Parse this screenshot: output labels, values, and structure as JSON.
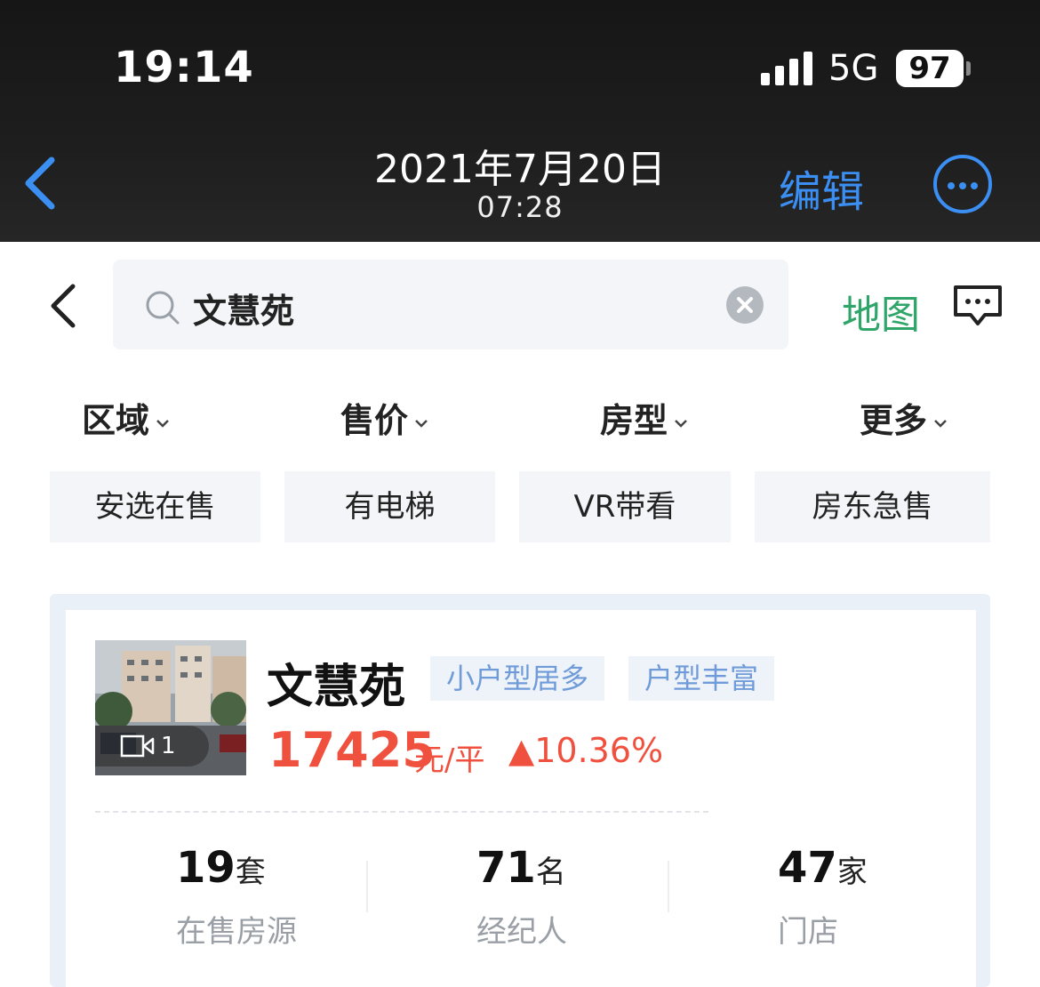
{
  "status_bar": {
    "time": "19:14",
    "network": "5G",
    "battery": "97"
  },
  "viewer": {
    "date": "2021年7月20日",
    "time": "07:28",
    "edit_label": "编辑"
  },
  "search": {
    "query": "文慧苑",
    "map_label": "地图"
  },
  "filters": [
    "区域",
    "售价",
    "房型",
    "更多"
  ],
  "quick_tags": [
    "安选在售",
    "有电梯",
    "VR带看",
    "房东急售"
  ],
  "community": {
    "name": "文慧苑",
    "tags": [
      "小户型居多",
      "户型丰富"
    ],
    "video_count": "1",
    "price": "17425",
    "price_unit": "元/平",
    "price_change": "▲10.36%",
    "stats": [
      {
        "value": "19",
        "unit": "套",
        "label": "在售房源"
      },
      {
        "value": "71",
        "unit": "名",
        "label": "经纪人"
      },
      {
        "value": "47",
        "unit": "家",
        "label": "门店"
      }
    ]
  },
  "colors": {
    "accent_blue": "#3b8ff2",
    "map_green": "#2fa56a",
    "price_red": "#f0513f",
    "tag_blue": "#6f9bd8"
  }
}
